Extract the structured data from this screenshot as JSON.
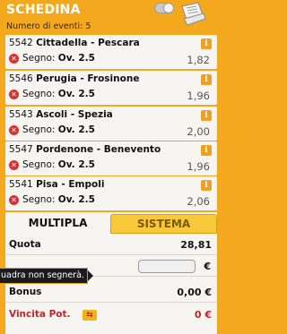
{
  "header": {
    "title": "SCHEDINA",
    "toggle_icon": "toggle-switch-icon",
    "paper_icon": "betslip-paper-icon"
  },
  "count": {
    "label": "Numero di eventi: 5"
  },
  "bets": [
    {
      "code": "5542",
      "teams": "Cittadella - Pescara",
      "segno_label": "Segno:",
      "pick": "Ov. 2.5",
      "odds": "1,82",
      "info_icon": "info-icon",
      "remove_icon": "remove-icon"
    },
    {
      "code": "5546",
      "teams": "Perugia - Frosinone",
      "segno_label": "Segno:",
      "pick": "Ov. 2.5",
      "odds": "1,96",
      "info_icon": "info-icon",
      "remove_icon": "remove-icon"
    },
    {
      "code": "5543",
      "teams": "Ascoli - Spezia",
      "segno_label": "Segno:",
      "pick": "Ov. 2.5",
      "odds": "2,00",
      "info_icon": "info-icon",
      "remove_icon": "remove-icon"
    },
    {
      "code": "5547",
      "teams": "Pordenone - Benevento",
      "segno_label": "Segno:",
      "pick": "Ov. 2.5",
      "odds": "1,96",
      "info_icon": "info-icon",
      "remove_icon": "remove-icon"
    },
    {
      "code": "5541",
      "teams": "Pisa - Empoli",
      "segno_label": "Segno:",
      "pick": "Ov. 2.5",
      "odds": "2,06",
      "info_icon": "info-icon",
      "remove_icon": "remove-icon"
    }
  ],
  "tabs": {
    "multipla": "MULTIPLA",
    "sistema": "SISTEMA"
  },
  "summary": {
    "quota_label": "Quota",
    "quota_value": "28,81",
    "stake_currency": "€",
    "bonus_label": "Bonus",
    "bonus_value": "0,00 €",
    "vincita_label": "Vincita Pot.",
    "vincita_value": "0 €",
    "vincita_icon_text": "⇆"
  },
  "tooltip": {
    "text": "uadra non segnerà."
  },
  "colors": {
    "panel_bg": "#f3a81e",
    "card_bg": "#f6f5f2",
    "accent_red": "#c0262d",
    "sistema_tab": "#f7c83a"
  }
}
